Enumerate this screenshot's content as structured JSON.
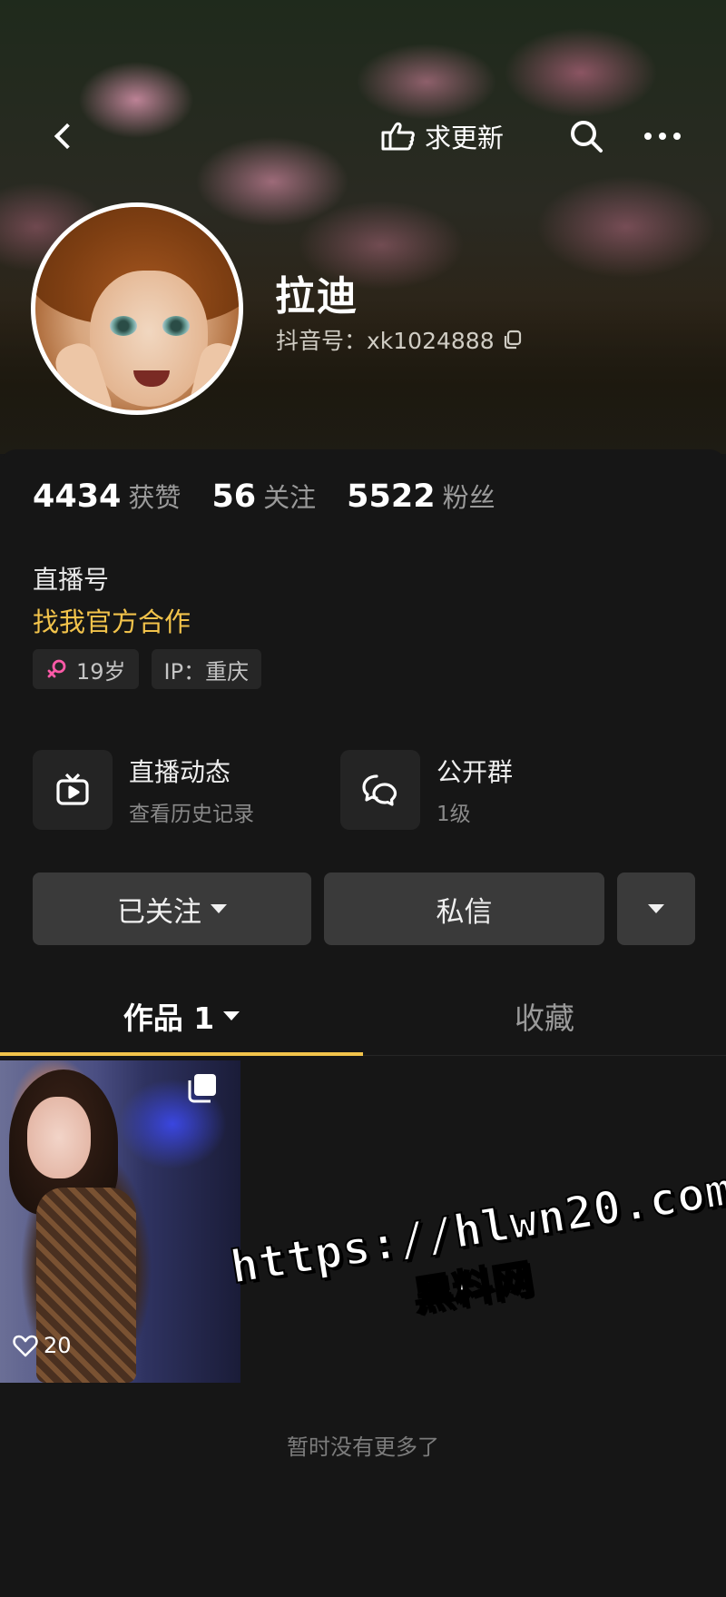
{
  "header": {
    "request_update_label": "求更新"
  },
  "profile": {
    "nickname": "拉迪",
    "douyin_id": "抖音号：xk1024888"
  },
  "stats": [
    {
      "value": "4434",
      "label": "获赞"
    },
    {
      "value": "56",
      "label": "关注"
    },
    {
      "value": "5522",
      "label": "粉丝"
    }
  ],
  "bio": {
    "line1": "直播号",
    "line2": "找我官方合作",
    "line2_color": "#f2c34b"
  },
  "tags": {
    "age": "19岁",
    "ip": "IP：重庆"
  },
  "features": {
    "live": {
      "title": "直播动态",
      "subtitle": "查看历史记录"
    },
    "group": {
      "title": "公开群",
      "subtitle": "1级"
    }
  },
  "actions": {
    "follow_label": "已关注",
    "message_label": "私信"
  },
  "tabs": {
    "works_label": "作品 1",
    "favorites_label": "收藏",
    "accent_color": "#f2c34b"
  },
  "video": {
    "likes": "20"
  },
  "watermark": {
    "url": "https://hlwn20.com",
    "brand": "黑料网"
  },
  "footer": {
    "no_more_text": "暂时没有更多了"
  }
}
